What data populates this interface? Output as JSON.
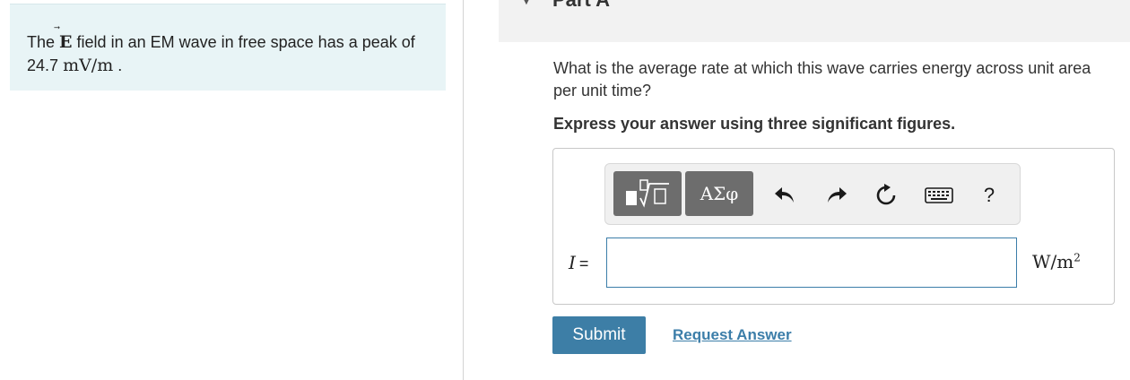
{
  "problem": {
    "text_before": "The",
    "vector_symbol": "E",
    "text_middle": "field in an EM wave in free space has a peak of 24.7",
    "value_units": "mV/m",
    "text_end": "."
  },
  "part": {
    "title": "Part A"
  },
  "question": {
    "text": "What is the average rate at which this wave carries energy across unit area per unit time?",
    "instruction": "Express your answer using three significant figures."
  },
  "toolbar": {
    "template_label": "▯√▯",
    "greek_label": "ΑΣφ",
    "undo_icon": "undo-icon",
    "redo_icon": "redo-icon",
    "reset_icon": "reset-icon",
    "keyboard_icon": "keyboard-icon",
    "help_label": "?"
  },
  "answer": {
    "variable": "I",
    "equals": "=",
    "value": "",
    "units_base": "W/m",
    "units_exp": "2"
  },
  "actions": {
    "submit_label": "Submit",
    "request_label": "Request Answer"
  },
  "colors": {
    "problem_bg": "#e8f4f6",
    "accent": "#3d7ea6",
    "toolbar_btn": "#6d6d6d"
  }
}
